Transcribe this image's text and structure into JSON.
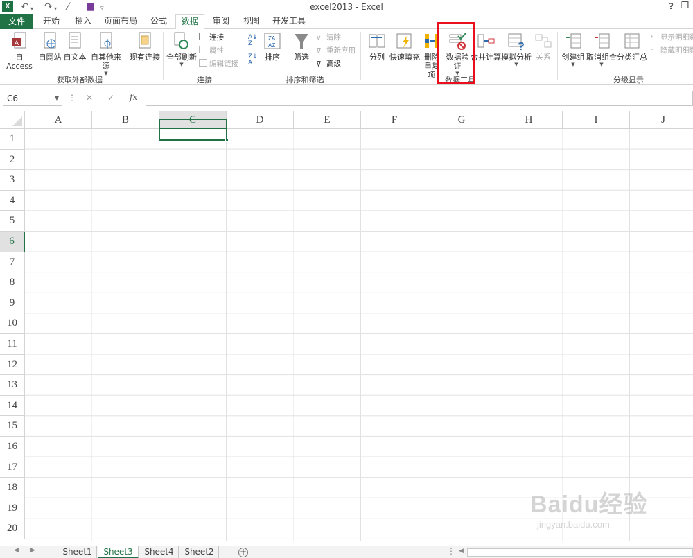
{
  "window": {
    "title": "excel2013 - Excel",
    "app_icon": "X",
    "help": "?",
    "restore_icon": "restore-icon"
  },
  "quick_access": [
    "save-icon",
    "undo-icon",
    "redo-icon",
    "magic-wand-icon",
    "customize-icon"
  ],
  "tabs": {
    "file": "文件",
    "items": [
      "开始",
      "插入",
      "页面布局",
      "公式",
      "数据",
      "审阅",
      "视图",
      "开发工具"
    ],
    "active": "数据"
  },
  "ribbon": {
    "get_external": {
      "group": "获取外部数据",
      "access": "自 Access",
      "web": "自网站",
      "text": "自文本",
      "other": "自其他来源",
      "existing": "现有连接"
    },
    "connections": {
      "group": "连接",
      "refresh_all": "全部刷新",
      "connections": "连接",
      "properties": "属性",
      "edit_links": "编辑链接"
    },
    "sort_filter": {
      "group": "排序和筛选",
      "sort": "排序",
      "filter": "筛选",
      "clear": "清除",
      "reapply": "重新应用",
      "advanced": "高级"
    },
    "data_tools": {
      "group": "数据工具",
      "text_to_columns": "分列",
      "flash_fill": "快速填充",
      "remove_dup_1": "删除",
      "remove_dup_2": "重复项",
      "validation_1": "数据验",
      "validation_2": "证",
      "consolidate": "合并计算",
      "what_if": "模拟分析",
      "relationships": "关系"
    },
    "outline": {
      "group": "分级显示",
      "group_btn": "创建组",
      "ungroup": "取消组合",
      "subtotal": "分类汇总",
      "show_detail": "显示明细数",
      "hide_detail": "隐藏明细数"
    }
  },
  "formula_bar": {
    "name_box": "C6",
    "cancel": "✕",
    "enter": "✓",
    "fx": "fx",
    "value": ""
  },
  "grid": {
    "columns": [
      "A",
      "B",
      "C",
      "D",
      "E",
      "F",
      "G",
      "H",
      "I",
      "J"
    ],
    "rows": [
      "1",
      "2",
      "3",
      "4",
      "5",
      "6",
      "7",
      "8",
      "9",
      "10",
      "11",
      "12",
      "13",
      "14",
      "15",
      "16",
      "17",
      "18",
      "19",
      "20"
    ],
    "active_cell": "C6",
    "selected_column": "C",
    "selected_row": "6"
  },
  "sheets": {
    "items": [
      "Sheet1",
      "Sheet3",
      "Sheet4",
      "Sheet2"
    ],
    "active": "Sheet3",
    "add": "+"
  },
  "watermark": {
    "line1": "Baidu经验",
    "line2": "jingyan.baidu.com"
  },
  "colors": {
    "excel_green": "#217346",
    "highlight": "#e8101a"
  }
}
